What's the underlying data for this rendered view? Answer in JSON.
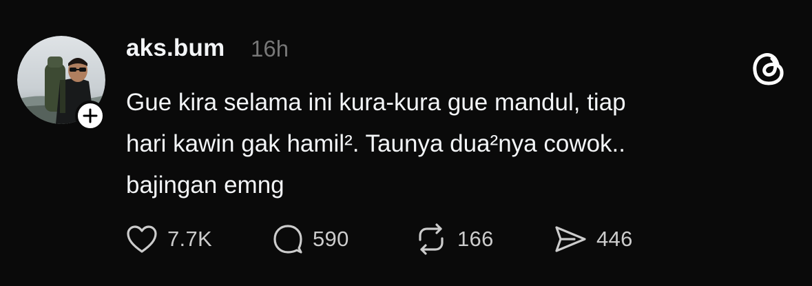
{
  "post": {
    "username": "aks.bum",
    "timestamp": "16h",
    "text_lines": [
      "Gue kira selama ini kura-kura gue mandul, tiap",
      "hari kawin gak hamil². Taunya dua²nya cowok..",
      "bajingan emng"
    ],
    "actions": {
      "likes": "7.7K",
      "replies": "590",
      "reposts": "166",
      "shares": "446"
    }
  },
  "icons": {
    "avatar": "avatar-photo",
    "follow": "plus-icon",
    "brand": "threads-logo-icon",
    "like": "heart-icon",
    "reply": "speech-bubble-icon",
    "repost": "repost-icon",
    "share": "send-icon"
  },
  "colors": {
    "background": "#0a0a0a",
    "primary_text": "#f3f5f7",
    "secondary_text": "#777777",
    "icon": "#cccccc"
  }
}
